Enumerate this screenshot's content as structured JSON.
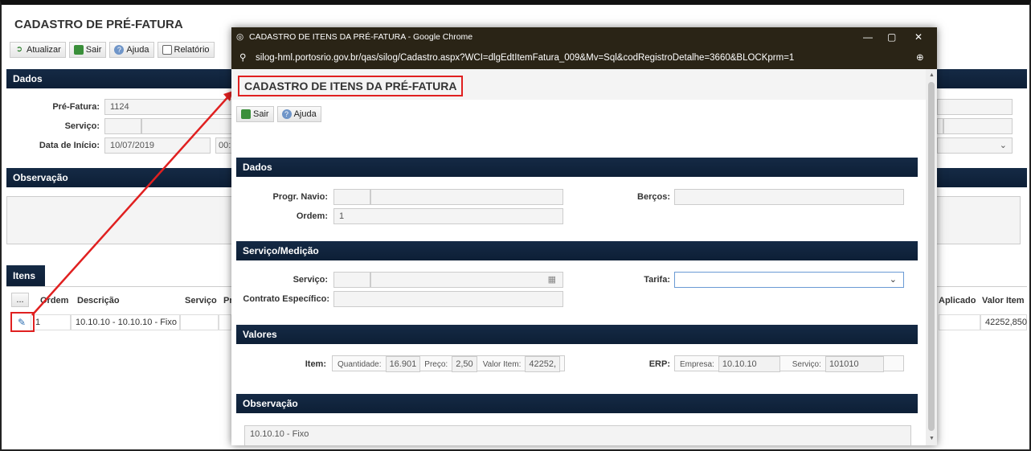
{
  "main": {
    "title": "CADASTRO DE PRÉ-FATURA",
    "toolbar": {
      "refresh": "Atualizar",
      "exit": "Sair",
      "help": "Ajuda",
      "report": "Relatório"
    },
    "sections": {
      "dados": "Dados",
      "observacao": "Observação",
      "itens": "Itens"
    },
    "fields": {
      "pre_fatura_label": "Pré-Fatura:",
      "pre_fatura_value": "1124",
      "servico_label": "Serviço:",
      "data_inicio_label": "Data de Início:",
      "data_inicio_value": "10/07/2019",
      "hora_value": "00:"
    },
    "grid": {
      "headers": {
        "more": "...",
        "ordem": "Ordem",
        "descricao": "Descrição",
        "servico": "Serviço",
        "p": "Pr",
        "aplicado": "Aplicado",
        "valor_item": "Valor Item"
      },
      "rows": [
        {
          "ordem": "1",
          "descricao": "10.10.10 - 10.10.10 - Fixo",
          "valor_item": "42252,850"
        }
      ]
    }
  },
  "popup": {
    "window_title": "CADASTRO DE ITENS DA PRÉ-FATURA - Google Chrome",
    "url": "silog-hml.portosrio.gov.br/qas/silog/Cadastro.aspx?WCI=dlgEdtItemFatura_009&Mv=Sql&codRegistroDetalhe=3660&BLOCKprm=1",
    "title": "CADASTRO DE ITENS DA PRÉ-FATURA",
    "toolbar": {
      "exit": "Sair",
      "help": "Ajuda"
    },
    "sections": {
      "dados": "Dados",
      "servico_medicao": "Serviço/Medição",
      "valores": "Valores",
      "observacao": "Observação"
    },
    "dados": {
      "prog_navio_label": "Progr. Navio:",
      "bercos_label": "Berços:",
      "ordem_label": "Ordem:",
      "ordem_value": "1"
    },
    "servico": {
      "servico_label": "Serviço:",
      "tarifa_label": "Tarifa:",
      "contrato_label": "Contrato Específico:"
    },
    "valores": {
      "item_label": "Item:",
      "quantidade_label": "Quantidade:",
      "quantidade_value": "16.901",
      "preco_label": "Preço:",
      "preco_value": "2,50",
      "valor_item_label": "Valor Item:",
      "valor_item_value": "42252,",
      "erp_label": "ERP:",
      "empresa_label": "Empresa:",
      "empresa_value": "10.10.10",
      "servico_label": "Serviço:",
      "servico_value": "101010"
    },
    "observacao_value": "10.10.10 - Fixo"
  },
  "colors": {
    "section_bg": "#0d1f36",
    "highlight": "#e02020",
    "chrome_bar": "#2a2416"
  }
}
